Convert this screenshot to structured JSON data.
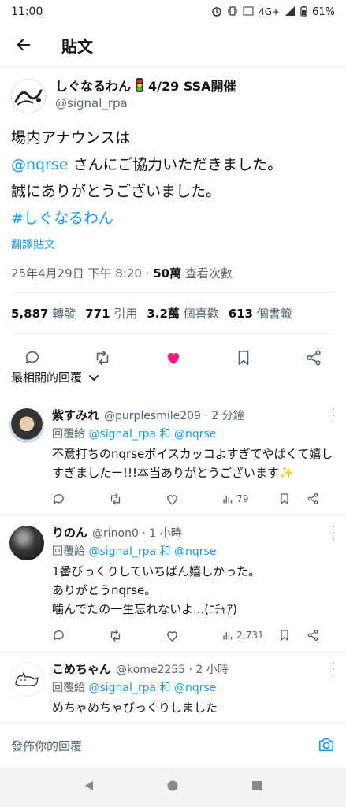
{
  "status_bar": {
    "time": "11:00",
    "network": "4G+",
    "battery": "61%"
  },
  "header": {
    "title": "貼文"
  },
  "post": {
    "author_name": "しぐなるわん",
    "author_name_suffix": "4/29 SSA開催",
    "author_handle": "@signal_rpa",
    "logo_text": "しぐなるわん",
    "body_line1": "場内アナウンスは",
    "body_mention": "@nqrse",
    "body_line2_rest": " さんにご協力いただきました。",
    "body_line3": "誠にありがとうございました。",
    "body_hashtag": "#しぐなるわん",
    "translate_label": "翻譯貼文",
    "timestamp": "25年4月29日 下午 8:20 · ",
    "views_count": "50萬",
    "views_label": " 查看次數"
  },
  "stats": {
    "reposts_count": "5,887",
    "reposts_label": " 轉發",
    "quotes_count": "771",
    "quotes_label": " 引用",
    "likes_count": "3.2萬",
    "likes_label": " 個喜歡",
    "bookmarks_count": "613",
    "bookmarks_label": " 個書籤"
  },
  "sort": {
    "label": "最相關的回覆"
  },
  "replies": [
    {
      "name": "紫すみれ",
      "handle": "@purplesmile209 · 2 分鐘",
      "reply_to_prefix": "回覆給 ",
      "reply_to_users": "@signal_rpa 和 @nqrse",
      "text": "不意打ちのnqrseボイスカッコよすぎてやばくて嬉しすぎましたー!!!本当ありがとうございます✨",
      "views": "79"
    },
    {
      "name": "りのん",
      "handle": "@rinon0 · 1 小時",
      "reply_to_prefix": "回覆給 ",
      "reply_to_users": "@signal_rpa 和 @nqrse",
      "text_line1": "1番びっくりしていちばん嬉しかった。",
      "text_line2": "ありがとうnqrse。",
      "text_line3": "噛んでたの一生忘れないよ...(ﾆﾁｬｱ)",
      "views": "2,731"
    },
    {
      "name": "こめちゃん",
      "handle": "@kome2255 · 2 小時",
      "reply_to_prefix": "回覆給 ",
      "reply_to_users": "@signal_rpa 和 @nqrse",
      "text": "めちゃめちゃびっくりしました"
    }
  ],
  "compose": {
    "placeholder": "發佈你的回覆"
  },
  "colors": {
    "accent": "#1d9bf0",
    "like": "#f91880",
    "secondary_text": "#536471"
  }
}
